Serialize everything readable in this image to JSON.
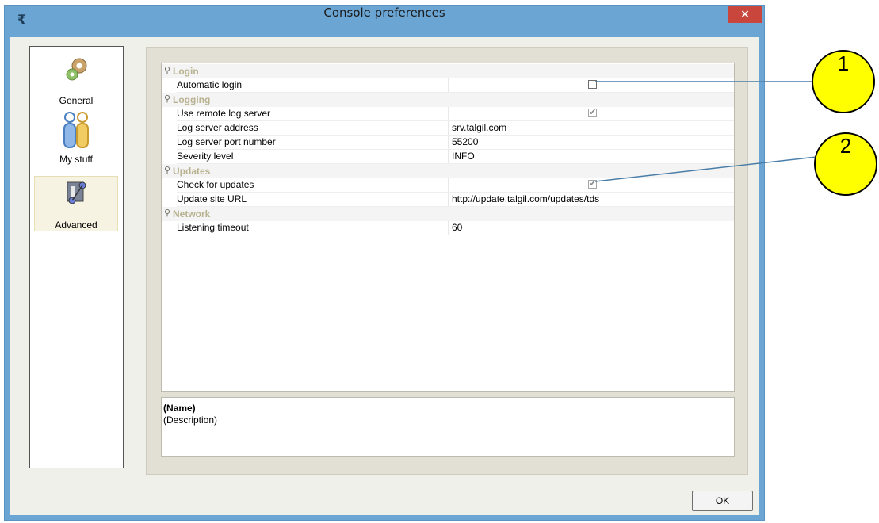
{
  "window": {
    "title": "Console preferences",
    "close_glyph": "×",
    "app_icon_glyph": "₹"
  },
  "categories": [
    {
      "label": "General",
      "icon": "gear-icon"
    },
    {
      "label": "My stuff",
      "icon": "people-icon"
    },
    {
      "label": "Advanced",
      "icon": "advanced-icon",
      "selected": true
    }
  ],
  "groups": {
    "login": {
      "label": "Login",
      "rows": [
        {
          "name": "Automatic login",
          "type": "checkbox",
          "checked": false
        }
      ]
    },
    "logging": {
      "label": "Logging",
      "rows": [
        {
          "name": "Use remote log server",
          "type": "checkbox",
          "checked": true
        },
        {
          "name": "Log server address",
          "value": "srv.talgil.com"
        },
        {
          "name": "Log server port number",
          "value": "55200"
        },
        {
          "name": "Severity level",
          "value": "INFO"
        }
      ]
    },
    "updates": {
      "label": "Updates",
      "rows": [
        {
          "name": "Check for updates",
          "type": "checkbox",
          "checked": true
        },
        {
          "name": "Update site URL",
          "value": "http://update.talgil.com/updates/tds"
        }
      ]
    },
    "network": {
      "label": "Network",
      "rows": [
        {
          "name": "Listening timeout",
          "value": "60"
        }
      ]
    }
  },
  "description": {
    "name": "(Name)",
    "text": "(Description)"
  },
  "buttons": {
    "ok": "OK"
  },
  "callouts": [
    "1",
    "2"
  ],
  "colors": {
    "callout_fill": "#ffff00",
    "callout_line": "#4a7ea8",
    "title_bar": "#6aa5d4"
  }
}
